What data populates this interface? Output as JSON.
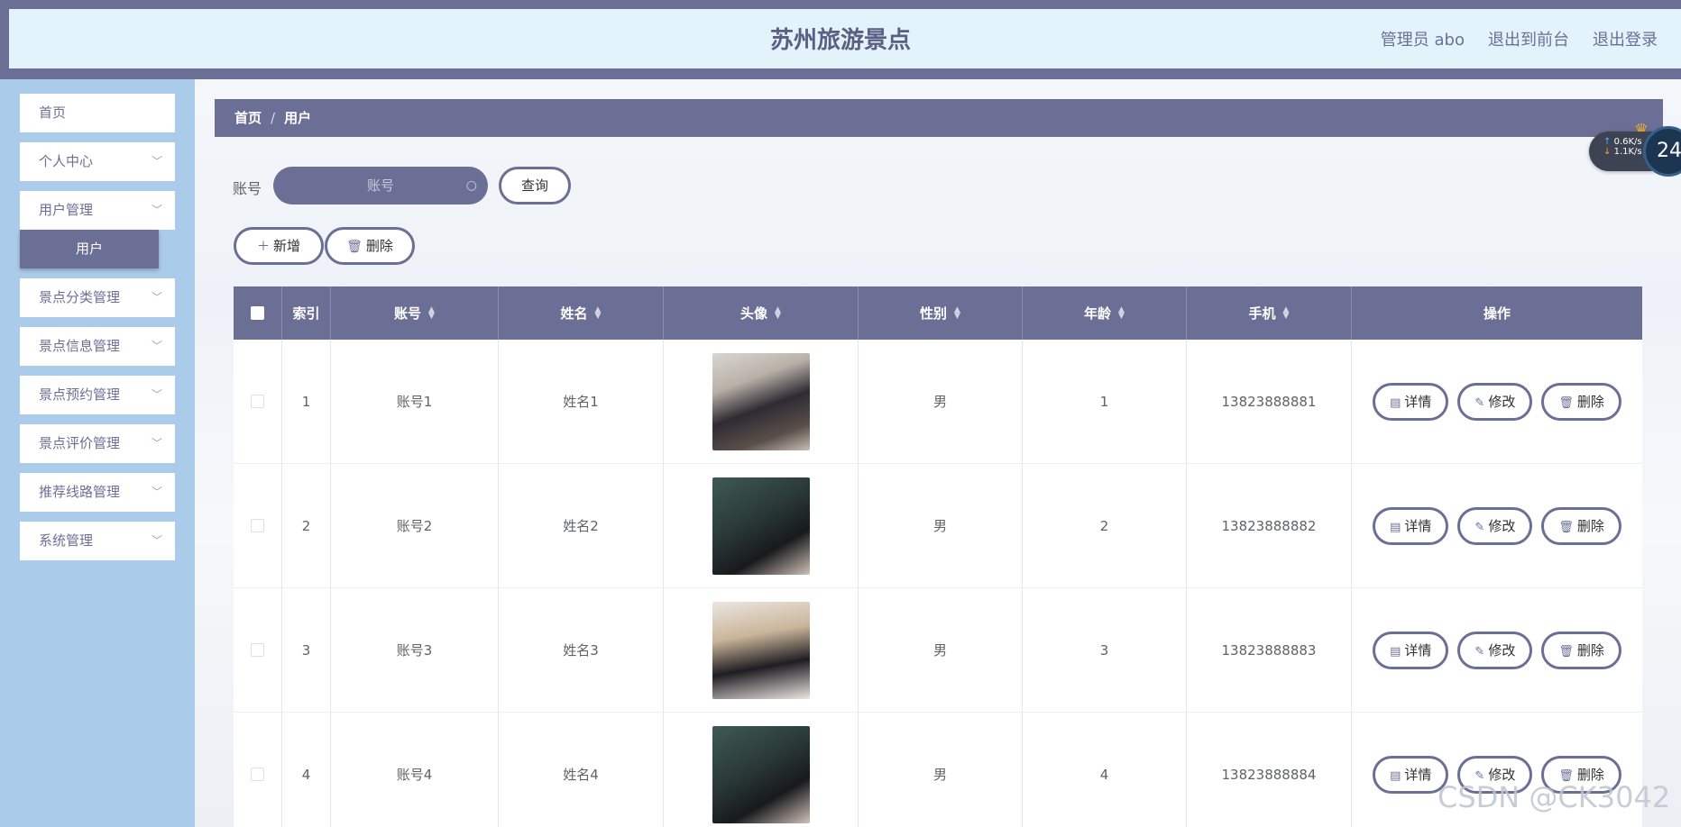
{
  "header": {
    "title": "苏州旅游景点",
    "links": [
      "管理员 abo",
      "退出到前台",
      "退出登录"
    ]
  },
  "sidebar": {
    "items": [
      {
        "label": "首页",
        "expandable": false
      },
      {
        "label": "个人中心",
        "expandable": true
      },
      {
        "label": "用户管理",
        "expandable": true
      },
      {
        "label": "景点分类管理",
        "expandable": true
      },
      {
        "label": "景点信息管理",
        "expandable": true
      },
      {
        "label": "景点预约管理",
        "expandable": true
      },
      {
        "label": "景点评价管理",
        "expandable": true
      },
      {
        "label": "推荐线路管理",
        "expandable": true
      },
      {
        "label": "系统管理",
        "expandable": true
      }
    ],
    "active_sub": "用户"
  },
  "breadcrumb": [
    "首页",
    "用户"
  ],
  "search": {
    "label": "账号",
    "placeholder": "账号",
    "query_button": "查询"
  },
  "toolbar": {
    "add_label": "新增",
    "delete_label": "删除"
  },
  "table": {
    "headers": [
      "索引",
      "账号",
      "姓名",
      "头像",
      "性别",
      "年龄",
      "手机",
      "操作"
    ],
    "rows": [
      {
        "index": "1",
        "account": "账号1",
        "name": "姓名1",
        "gender": "男",
        "age": "1",
        "phone": "13823888881"
      },
      {
        "index": "2",
        "account": "账号2",
        "name": "姓名2",
        "gender": "男",
        "age": "2",
        "phone": "13823888882"
      },
      {
        "index": "3",
        "account": "账号3",
        "name": "姓名3",
        "gender": "男",
        "age": "3",
        "phone": "13823888883"
      },
      {
        "index": "4",
        "account": "账号4",
        "name": "姓名4",
        "gender": "男",
        "age": "4",
        "phone": "13823888884"
      }
    ],
    "actions": {
      "detail": "详情",
      "edit": "修改",
      "delete": "删除"
    }
  },
  "overlay": {
    "upload_speed": "0.6K/s",
    "download_speed": "1.1K/s",
    "circle_text": "24",
    "watermark": "CSDN @CK3042"
  },
  "colors": {
    "accent": "#6b6f96",
    "header_bg": "#e3f3fc",
    "sidebar_bg": "#aacbe9"
  }
}
